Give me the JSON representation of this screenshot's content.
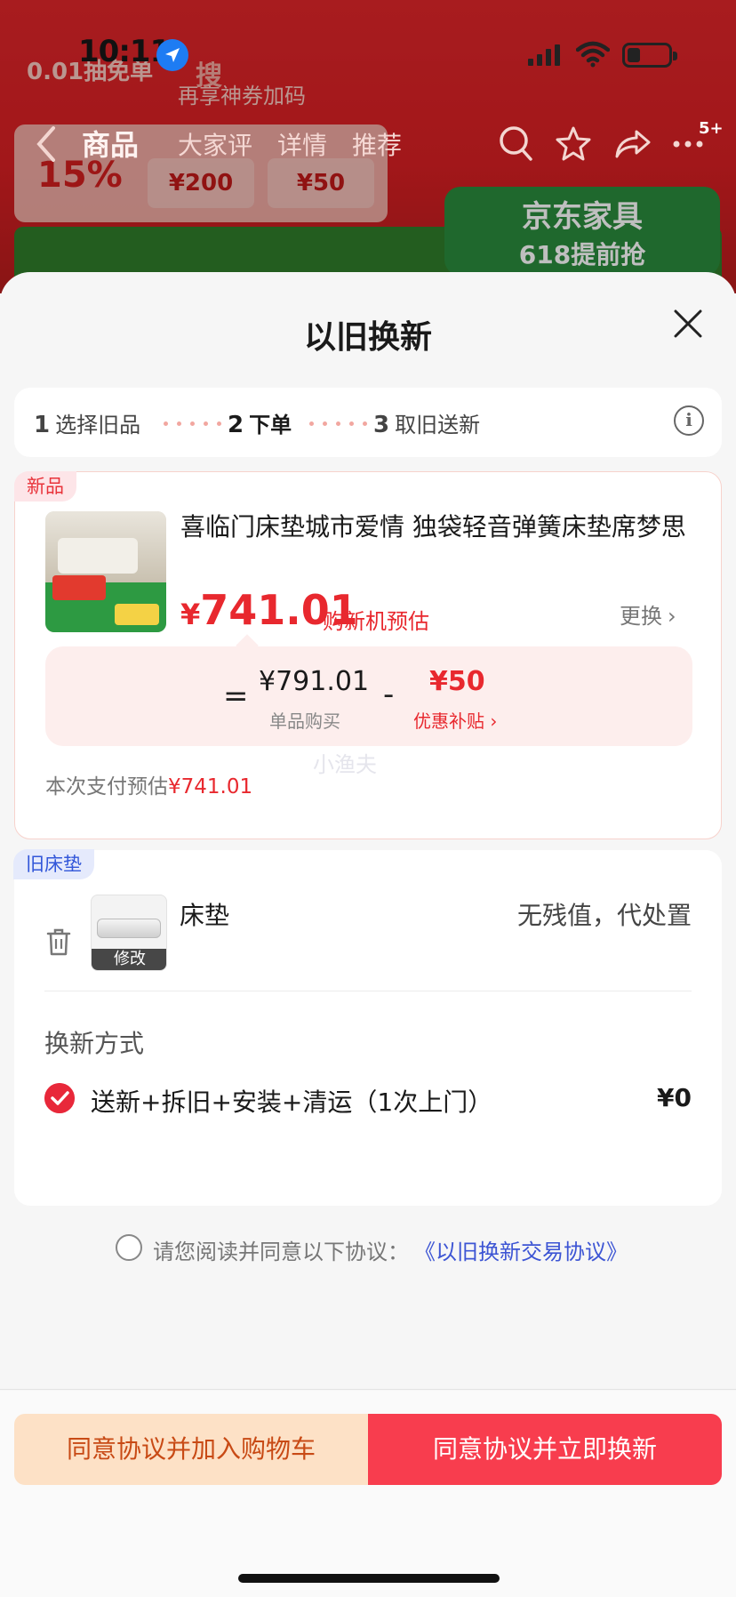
{
  "status_bar": {
    "time": "10:11"
  },
  "background": {
    "promo_line1": "0.01抽免单",
    "promo_line2": "再享神券加码",
    "promo_line3": "搜",
    "discount": "15%",
    "coupon1": "¥200",
    "coupon2": "¥50",
    "jd_brand": "京东家具",
    "jd_event": "618提前抢"
  },
  "nav": {
    "tabs": [
      "商品",
      "大家评",
      "详情",
      "推荐"
    ],
    "badge": "5+"
  },
  "sheet": {
    "title": "以旧换新",
    "steps": [
      {
        "num": "1",
        "label": "选择旧品"
      },
      {
        "num": "2",
        "label": "下单"
      },
      {
        "num": "3",
        "label": "取旧送新"
      }
    ],
    "info_glyph": "i"
  },
  "new_item": {
    "tag": "新品",
    "title": "喜临门床垫城市爱情 独袋轻音弹簧床垫席梦思",
    "price_yen": "¥",
    "price_value": "741.01",
    "price_note": "购新机预估",
    "swap_label": "更换",
    "calc": {
      "equals": "=",
      "single_price": "¥791.01",
      "single_label": "单品购买",
      "minus": "-",
      "subsidy": "¥50",
      "subsidy_label": "优惠补贴 ›"
    },
    "pay_est_label": "本次支付预估",
    "pay_est_value": "¥741.01"
  },
  "watermark": "小渔夫",
  "old_item": {
    "tag": "旧床垫",
    "name": "床垫",
    "value": "无残值，代处置",
    "edit_label": "修改",
    "method_title": "换新方式",
    "method_label": "送新+拆旧+安装+清运（1次上门）",
    "method_price": "¥0"
  },
  "agreement": {
    "text": "请您阅读并同意以下协议：",
    "link": "《以旧换新交易协议》"
  },
  "buttons": {
    "add_to_cart": "同意协议并加入购物车",
    "exchange_now": "同意协议并立即换新"
  },
  "colors": {
    "accent_red": "#e8282e",
    "button_red": "#f83d4e",
    "button_peach": "#fde1c6",
    "link_blue": "#3d55d4"
  }
}
